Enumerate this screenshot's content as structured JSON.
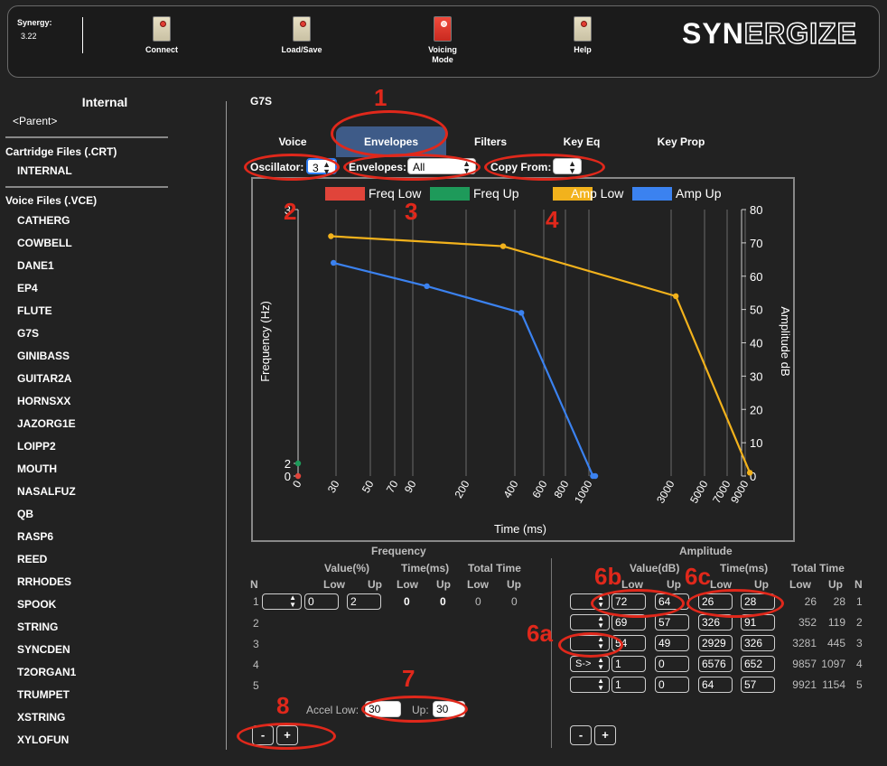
{
  "header": {
    "version_label": "Synergy:",
    "version_value": "3.22",
    "buttons": [
      {
        "label": "Connect",
        "state": "off"
      },
      {
        "label": "Load/Save",
        "state": "off"
      },
      {
        "label": "Voicing\nMode",
        "state": "on"
      },
      {
        "label": "Help",
        "state": "off"
      }
    ],
    "logo_bold": "SYN",
    "logo_outline": "ERGIZE"
  },
  "sidebar": {
    "title": "Internal",
    "parent": "<Parent>",
    "cartridge_title": "Cartridge Files (.CRT)",
    "cartridge_items": [
      "INTERNAL"
    ],
    "voice_title": "Voice Files (.VCE)",
    "voice_items": [
      "CATHERG",
      "COWBELL",
      "DANE1",
      "EP4",
      "FLUTE",
      "G7S",
      "GINIBASS",
      "GUITAR2A",
      "HORNSXX",
      "JAZORG1E",
      "LOIPP2",
      "MOUTH",
      "NASALFUZ",
      "QB",
      "RASP6",
      "REED",
      "RRHODES",
      "SPOOK",
      "STRING",
      "SYNCDEN",
      "T2ORGAN1",
      "TRUMPET",
      "XSTRING",
      "XYLOFUN"
    ]
  },
  "main": {
    "voice_name": "G7S",
    "tabs": [
      "Voice",
      "Envelopes",
      "Filters",
      "Key Eq",
      "Key Prop"
    ],
    "active_tab": "Envelopes",
    "oscillator_label": "Oscillator:",
    "oscillator_value": "3",
    "envelopes_label": "Envelopes:",
    "envelopes_value": "All",
    "copy_from_label": "Copy From:",
    "copy_from_value": ""
  },
  "chart_data": {
    "type": "line",
    "legend": [
      {
        "name": "Freq Low",
        "color": "#e0443a"
      },
      {
        "name": "Freq Up",
        "color": "#1e9a5a"
      },
      {
        "name": "Amp Low",
        "color": "#f2b21c"
      },
      {
        "name": "Amp Up",
        "color": "#3b82f0"
      }
    ],
    "x_ticks": [
      "0",
      "30",
      "50",
      "70",
      "90",
      "200",
      "400",
      "600",
      "800",
      "1000",
      "3000",
      "5000",
      "7000",
      "9000"
    ],
    "x_tick_values": [
      0,
      30,
      50,
      70,
      90,
      200,
      400,
      600,
      800,
      1000,
      3000,
      5000,
      7000,
      9000
    ],
    "xlabel": "Time (ms)",
    "ylabel_left": "Frequency (Hz)",
    "ylabel_right": "Amplitude dB",
    "y_left_ticks": [
      "0",
      "2",
      "3"
    ],
    "y_right_ticks": [
      "0",
      "10",
      "20",
      "30",
      "40",
      "50",
      "60",
      "70",
      "80"
    ],
    "series": [
      {
        "name": "Freq Low",
        "color": "#e0443a",
        "axis": "left",
        "points": [
          [
            0,
            0
          ]
        ]
      },
      {
        "name": "Freq Up",
        "color": "#1e9a5a",
        "axis": "left",
        "points": [
          [
            0,
            2
          ]
        ]
      },
      {
        "name": "Amp Low",
        "color": "#f2b21c",
        "axis": "right",
        "points": [
          [
            26,
            72
          ],
          [
            352,
            69
          ],
          [
            3281,
            54
          ],
          [
            9857,
            1
          ]
        ]
      },
      {
        "name": "Amp Up",
        "color": "#3b82f0",
        "axis": "right",
        "points": [
          [
            28,
            64
          ],
          [
            119,
            57
          ],
          [
            445,
            49
          ],
          [
            1097,
            0
          ],
          [
            1154,
            0
          ]
        ]
      }
    ]
  },
  "table": {
    "freq_title": "Frequency",
    "amp_title": "Amplitude",
    "freq_headers": {
      "n": "N",
      "value": "Value(%)",
      "time": "Time(ms)",
      "total": "Total Time",
      "low": "Low",
      "up": "Up"
    },
    "amp_headers": {
      "value": "Value(dB)",
      "time": "Time(ms)",
      "total": "Total Time",
      "low": "Low",
      "up": "Up",
      "n": "N"
    },
    "freq_rows": [
      {
        "n": "1",
        "value_low": "0",
        "value_up": "2",
        "time_low": "0",
        "time_up": "0",
        "total_low": "0",
        "total_up": "0"
      },
      {
        "n": "2"
      },
      {
        "n": "3"
      },
      {
        "n": "4"
      },
      {
        "n": "5"
      }
    ],
    "amp_rows": [
      {
        "sel": "",
        "value_low": "72",
        "value_up": "64",
        "time_low": "26",
        "time_up": "28",
        "total_low": "26",
        "total_up": "28",
        "n": "1"
      },
      {
        "sel": "",
        "value_low": "69",
        "value_up": "57",
        "time_low": "326",
        "time_up": "91",
        "total_low": "352",
        "total_up": "119",
        "n": "2"
      },
      {
        "sel": "",
        "value_low": "54",
        "value_up": "49",
        "time_low": "2929",
        "time_up": "326",
        "total_low": "3281",
        "total_up": "445",
        "n": "3"
      },
      {
        "sel": "S->",
        "value_low": "1",
        "value_up": "0",
        "time_low": "6576",
        "time_up": "652",
        "total_low": "9857",
        "total_up": "1097",
        "n": "4"
      },
      {
        "sel": "",
        "value_low": "1",
        "value_up": "0",
        "time_low": "64",
        "time_up": "57",
        "total_low": "9921",
        "total_up": "1154",
        "n": "5"
      }
    ],
    "accel_low_label": "Accel Low:",
    "accel_low_value": "30",
    "accel_up_label": "Up:",
    "accel_up_value": "30",
    "minus_label": "-",
    "plus_label": "+"
  },
  "annotations": {
    "n1": "1",
    "n2": "2",
    "n3": "3",
    "n4": "4",
    "n6a": "6a",
    "n6b": "6b",
    "n6c": "6c",
    "n7": "7",
    "n8": "8",
    "color": "#e0281b"
  }
}
